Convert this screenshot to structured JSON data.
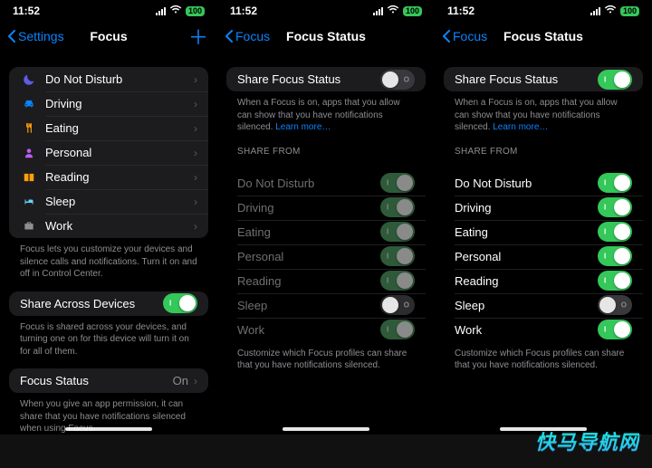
{
  "status": {
    "time": "11:52",
    "battery": "100"
  },
  "phone1": {
    "back": "Settings",
    "title": "Focus",
    "modes": [
      {
        "label": "Do Not Disturb",
        "icon": "moon",
        "color": "#5e5ce6"
      },
      {
        "label": "Driving",
        "icon": "car",
        "color": "#0a84ff"
      },
      {
        "label": "Eating",
        "icon": "fork",
        "color": "#ff9f0a"
      },
      {
        "label": "Personal",
        "icon": "person",
        "color": "#bf5af2"
      },
      {
        "label": "Reading",
        "icon": "book",
        "color": "#ff9f0a"
      },
      {
        "label": "Sleep",
        "icon": "bed",
        "color": "#64d2ff"
      },
      {
        "label": "Work",
        "icon": "case",
        "color": "#8e8e93"
      }
    ],
    "modes_footer": "Focus lets you customize your devices and silence calls and notifications. Turn it on and off in Control Center.",
    "share_devices": {
      "label": "Share Across Devices",
      "on": true
    },
    "share_devices_footer": "Focus is shared across your devices, and turning one on for this device will turn it on for all of them.",
    "focus_status": {
      "label": "Focus Status",
      "detail": "On"
    },
    "focus_status_footer": "When you give an app permission, it can share that you have notifications silenced when using Focus."
  },
  "phone2": {
    "back": "Focus",
    "title": "Focus Status",
    "share_row": {
      "label": "Share Focus Status",
      "on": false
    },
    "share_footer": "When a Focus is on, apps that you allow can show that you have notifications silenced. ",
    "learn_more": "Learn more…",
    "section": "SHARE FROM",
    "items": [
      {
        "label": "Do Not Disturb",
        "on": true
      },
      {
        "label": "Driving",
        "on": true
      },
      {
        "label": "Eating",
        "on": true
      },
      {
        "label": "Personal",
        "on": true
      },
      {
        "label": "Reading",
        "on": true
      },
      {
        "label": "Sleep",
        "on": false
      },
      {
        "label": "Work",
        "on": true
      }
    ],
    "items_footer": "Customize which Focus profiles can share that you have notifications silenced."
  },
  "phone3": {
    "back": "Focus",
    "title": "Focus Status",
    "share_row": {
      "label": "Share Focus Status",
      "on": true
    },
    "share_footer": "When a Focus is on, apps that you allow can show that you have notifications silenced. ",
    "learn_more": "Learn more…",
    "section": "SHARE FROM",
    "items": [
      {
        "label": "Do Not Disturb",
        "on": true
      },
      {
        "label": "Driving",
        "on": true
      },
      {
        "label": "Eating",
        "on": true
      },
      {
        "label": "Personal",
        "on": true
      },
      {
        "label": "Reading",
        "on": true
      },
      {
        "label": "Sleep",
        "on": false
      },
      {
        "label": "Work",
        "on": true
      }
    ],
    "items_footer": "Customize which Focus profiles can share that you have notifications silenced."
  },
  "watermark": {
    "cn": "快马导航网",
    "en": ""
  }
}
